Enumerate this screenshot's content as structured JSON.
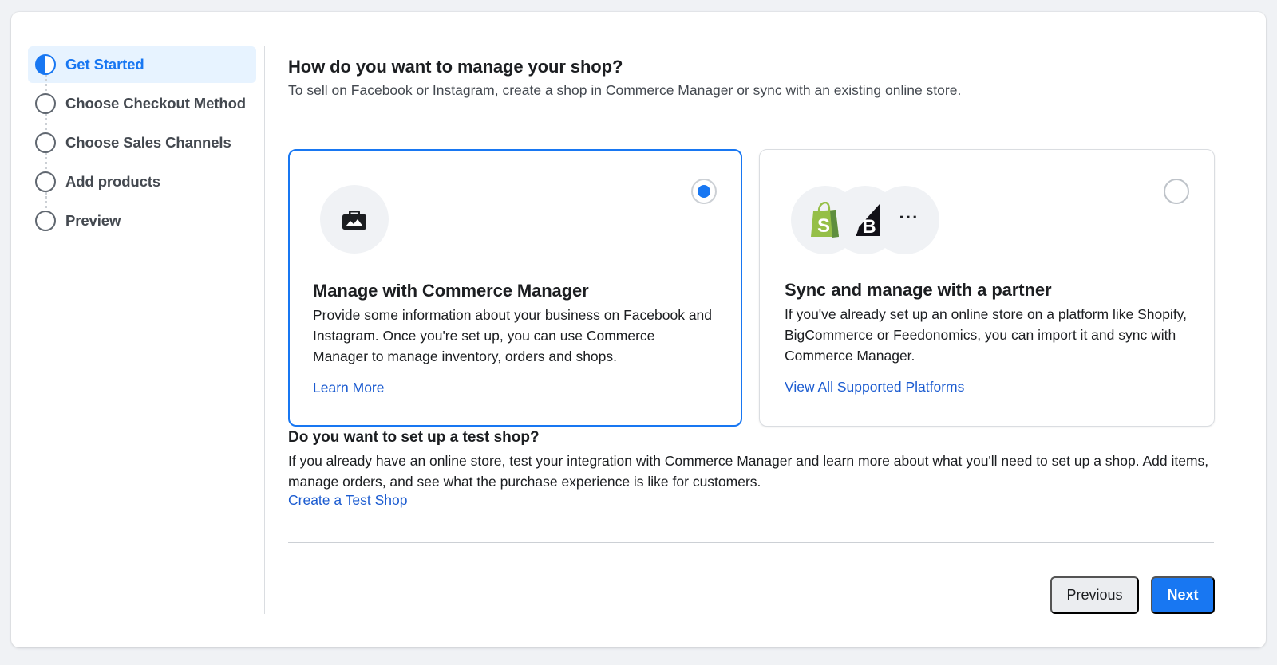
{
  "sidebar": {
    "steps": [
      {
        "label": "Get Started",
        "state": "active"
      },
      {
        "label": "Choose Checkout Method",
        "state": "pending"
      },
      {
        "label": "Choose Sales Channels",
        "state": "pending"
      },
      {
        "label": "Add products",
        "state": "pending"
      },
      {
        "label": "Preview",
        "state": "pending"
      }
    ]
  },
  "main": {
    "title": "How do you want to manage your shop?",
    "subtitle": "To sell on Facebook or Instagram, create a shop in Commerce Manager or sync with an existing online store.",
    "options": [
      {
        "title": "Manage with Commerce Manager",
        "description": "Provide some information about your business on Facebook and Instagram. Once you're set up, you can use Commerce Manager to manage inventory, orders and shops.",
        "link": "Learn More",
        "selected": true,
        "icon": "briefcase-icon"
      },
      {
        "title": "Sync and manage with a partner",
        "description": "If you've already set up an online store on a platform like Shopify, BigCommerce or Feedonomics, you can import it and sync with Commerce Manager.",
        "link": "View All Supported Platforms",
        "selected": false,
        "icons": [
          "shopify-icon",
          "bigcommerce-icon",
          "more-icon"
        ],
        "more_label": "···"
      }
    ],
    "test_shop": {
      "title": "Do you want to set up a test shop?",
      "description": "If you already have an online store, test your integration with Commerce Manager and learn more about what you'll need to set up a shop. Add items, manage orders, and see what the purchase experience is like for customers.",
      "link": "Create a Test Shop"
    }
  },
  "footer": {
    "previous_label": "Previous",
    "next_label": "Next"
  },
  "colors": {
    "accent": "#1877f2",
    "link": "#1b5bd0",
    "shopify_green": "#95bf47"
  }
}
